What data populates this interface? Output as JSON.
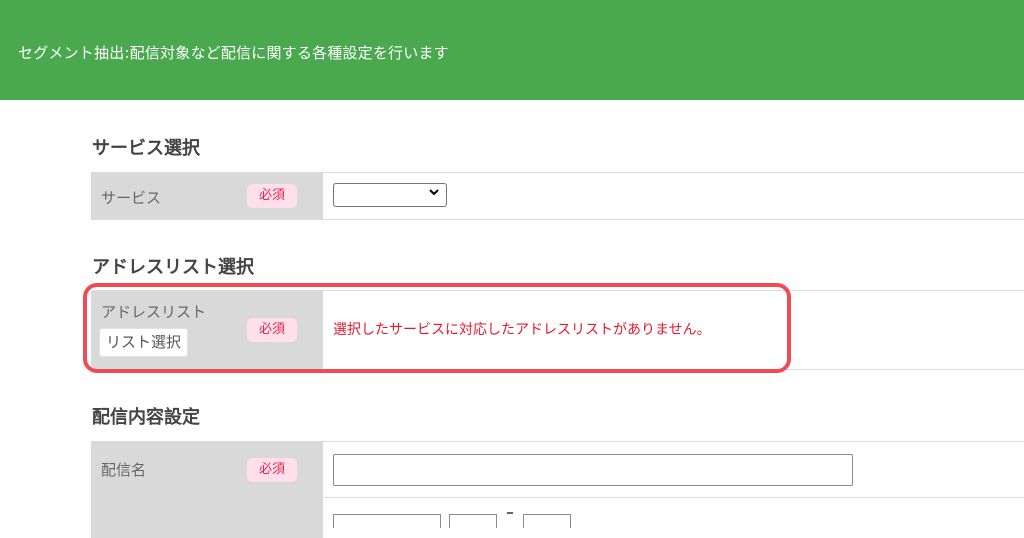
{
  "header": {
    "title": "セグメント抽出:配信対象など配信に関する各種設定を行います",
    "background_color": "#4aa84f"
  },
  "sections": {
    "service": {
      "title": "サービス選択",
      "label": "サービス",
      "required_label": "必須",
      "select_value": ""
    },
    "address_list": {
      "title": "アドレスリスト選択",
      "label": "アドレスリスト",
      "button_label": "リスト選択",
      "required_label": "必須",
      "error_message": "選択したサービスに対応したアドレスリストがありません。",
      "error_color": "#e8182f"
    },
    "delivery": {
      "title": "配信内容設定",
      "name_label": "配信名",
      "required_label": "必須",
      "name_value": ""
    }
  },
  "icons": {
    "select_arrow": "chevron-down-icon"
  },
  "colors": {
    "required_badge_bg": "#ffdfe9",
    "required_badge_text": "#e0284f",
    "highlight_frame": "#f04b55",
    "label_cell_bg": "#d9d9d9"
  }
}
